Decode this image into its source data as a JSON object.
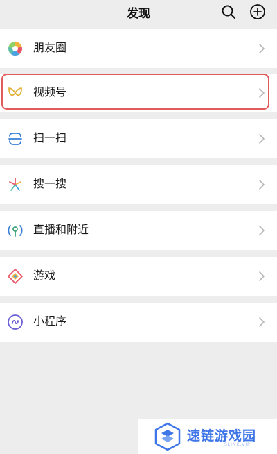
{
  "header": {
    "title": "发现",
    "search_icon": "search-icon",
    "add_icon": "plus-circle-icon"
  },
  "menu": [
    {
      "id": "moments",
      "label": "朋友圈",
      "icon": "moments-icon"
    },
    {
      "id": "channels",
      "label": "视频号",
      "icon": "channels-icon"
    },
    {
      "id": "scan",
      "label": "扫一扫",
      "icon": "scan-icon"
    },
    {
      "id": "search",
      "label": "搜一搜",
      "icon": "search-sparkle-icon"
    },
    {
      "id": "live-nearby",
      "label": "直播和附近",
      "icon": "live-nearby-icon"
    },
    {
      "id": "games",
      "label": "游戏",
      "icon": "games-icon"
    },
    {
      "id": "mini-programs",
      "label": "小程序",
      "icon": "mini-program-icon"
    }
  ],
  "highlighted_item": "视频号",
  "colors": {
    "background": "#ededed",
    "row": "#ffffff",
    "highlight_border": "#e25b5b",
    "chevron": "#b8b8b8",
    "watermark_blue": "#3e76e8"
  },
  "watermark": {
    "text": "速链游戏园",
    "subtext": "SLINK.VIP"
  }
}
